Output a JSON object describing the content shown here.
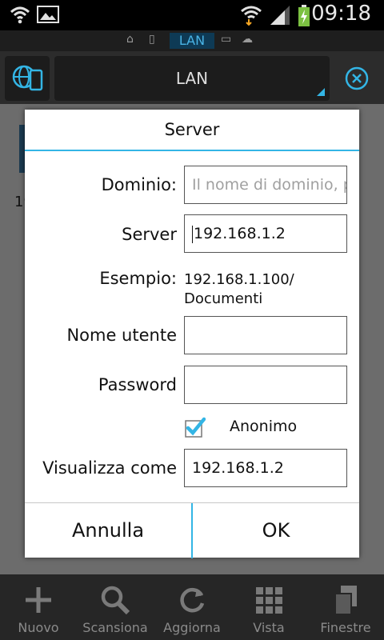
{
  "status": {
    "time": "09:18"
  },
  "locations": {
    "active": "LAN"
  },
  "toolbar": {
    "title": "LAN"
  },
  "content": {
    "partial_text": "19"
  },
  "dialog": {
    "title": "Server",
    "domain_label": "Dominio:",
    "domain_placeholder": "Il nome di dominio, p",
    "server_label": "Server",
    "server_value": "192.168.1.2",
    "example_label": "Esempio:",
    "example_line1": "192.168.1.100/",
    "example_line2": "Documenti",
    "username_label": "Nome utente",
    "username_value": "",
    "password_label": "Password",
    "password_value": "",
    "anonymous_label": "Anonimo",
    "anonymous_checked": true,
    "display_as_label": "Visualizza come",
    "display_as_value": "192.168.1.2",
    "cancel_label": "Annulla",
    "ok_label": "OK"
  },
  "bottombar": {
    "new": "Nuovo",
    "scan": "Scansiona",
    "refresh": "Aggiorna",
    "view": "Vista",
    "windows": "Finestre"
  },
  "colors": {
    "accent": "#33b5e5",
    "check": "#33b5e5"
  }
}
